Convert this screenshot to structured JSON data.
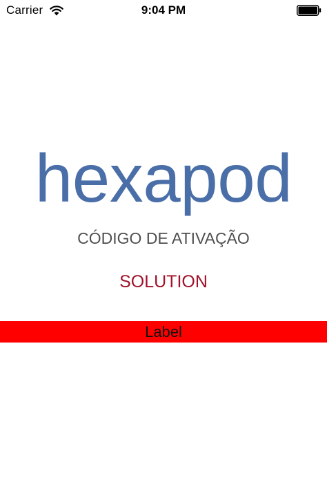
{
  "status_bar": {
    "carrier": "Carrier",
    "time": "9:04 PM",
    "wifi_icon": "wifi-icon",
    "battery_icon": "battery-icon",
    "battery_level": 1.0
  },
  "main": {
    "logo_text": "hexapod",
    "title": "CÓDIGO DE ATIVAÇÃO",
    "solution": "SOLUTION",
    "label": "Label"
  },
  "colors": {
    "logo": "#4a6ea8",
    "title": "#4f4f4f",
    "solution": "#a0122a",
    "label_background": "#ff0000",
    "background": "#ffffff"
  }
}
